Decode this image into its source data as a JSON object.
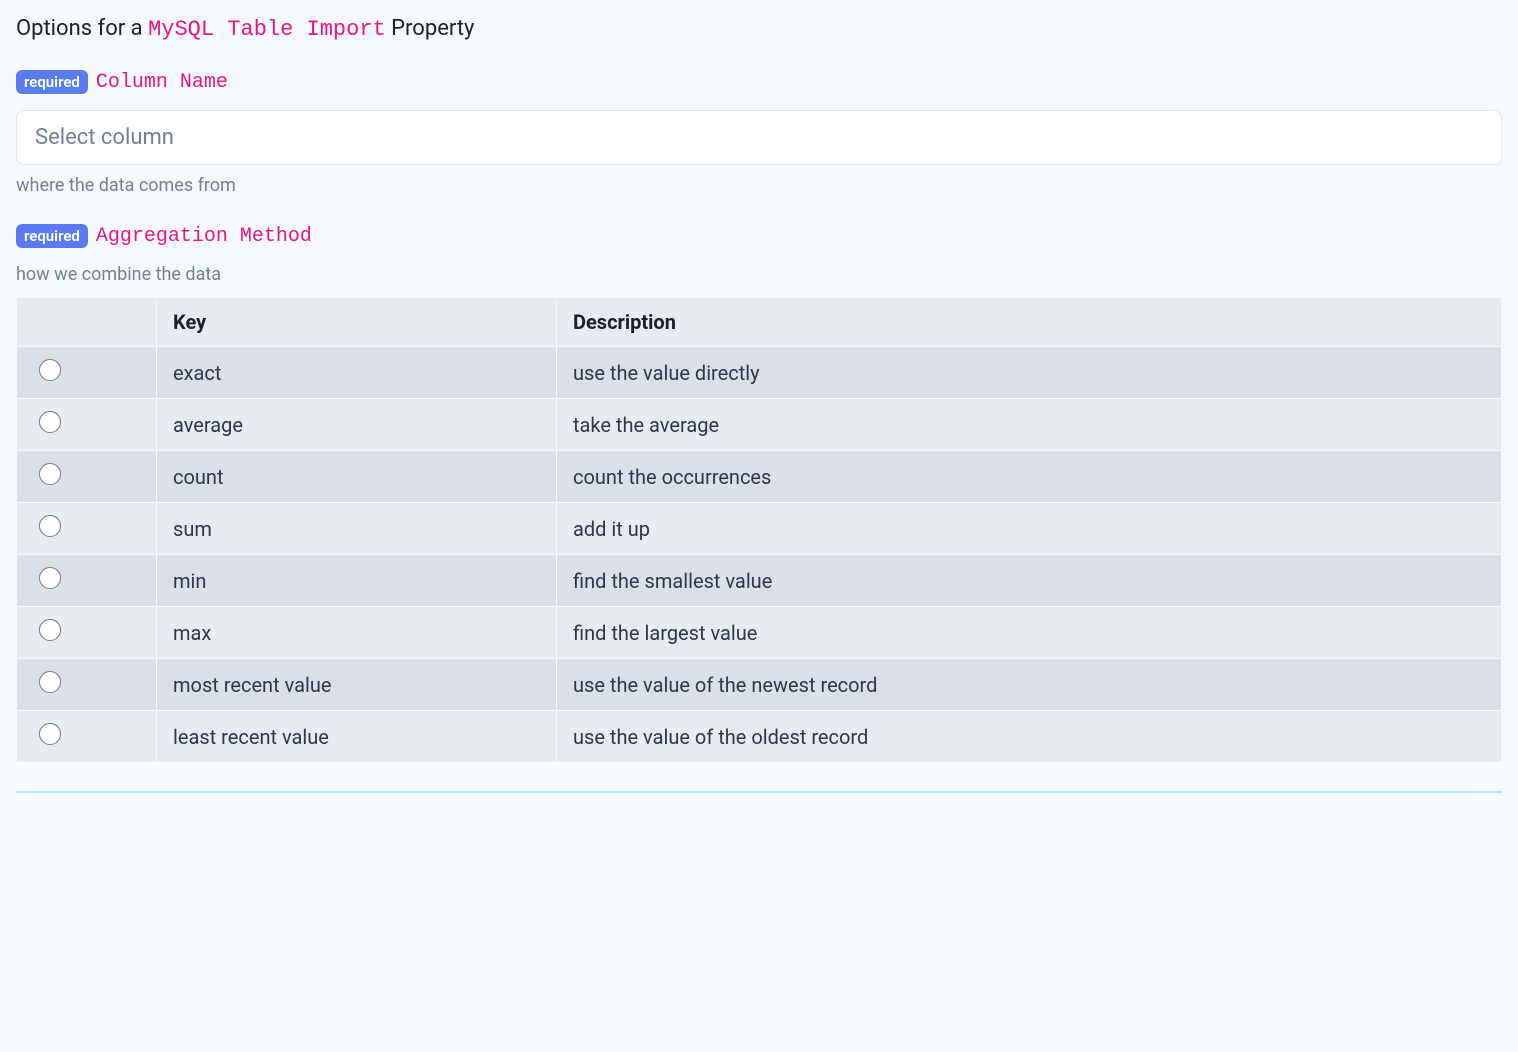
{
  "title": {
    "prefix": "Options for a ",
    "code": "MySQL Table Import",
    "suffix": " Property"
  },
  "required_badge": "required",
  "column_name": {
    "label": "Column Name",
    "placeholder": "Select column",
    "help": "where the data comes from"
  },
  "aggregation": {
    "label": "Aggregation Method",
    "help": "how we combine the data",
    "headers": {
      "key": "Key",
      "description": "Description"
    },
    "rows": [
      {
        "key": "exact",
        "description": "use the value directly"
      },
      {
        "key": "average",
        "description": "take the average"
      },
      {
        "key": "count",
        "description": "count the occurrences"
      },
      {
        "key": "sum",
        "description": "add it up"
      },
      {
        "key": "min",
        "description": "find the smallest value"
      },
      {
        "key": "max",
        "description": "find the largest value"
      },
      {
        "key": "most recent value",
        "description": "use the value of the newest record"
      },
      {
        "key": "least recent value",
        "description": "use the value of the oldest record"
      }
    ]
  }
}
